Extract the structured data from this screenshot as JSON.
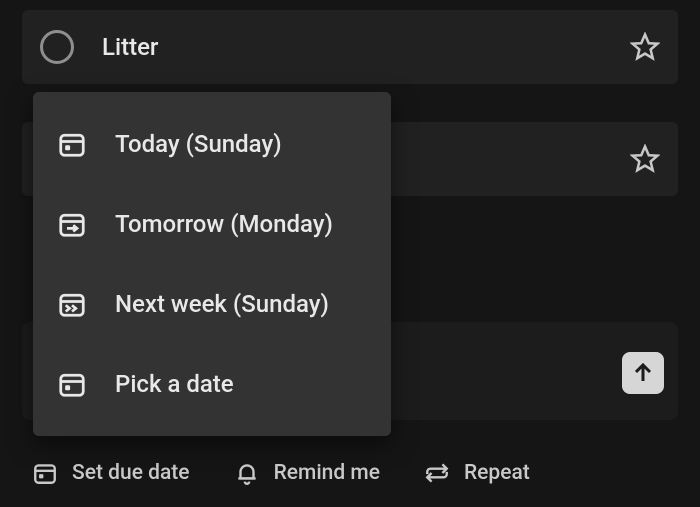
{
  "tasks": [
    {
      "title": "Litter",
      "starred": false
    },
    {
      "title": "",
      "starred": false
    }
  ],
  "popup": {
    "items": [
      {
        "label": "Today (Sunday)",
        "icon": "calendar-today-icon"
      },
      {
        "label": "Tomorrow (Monday)",
        "icon": "calendar-tomorrow-icon"
      },
      {
        "label": "Next week (Sunday)",
        "icon": "calendar-nextweek-icon"
      },
      {
        "label": "Pick a date",
        "icon": "calendar-pick-icon"
      }
    ]
  },
  "bottomActions": {
    "setDueDate": "Set due date",
    "remindMe": "Remind me",
    "repeat": "Repeat"
  }
}
